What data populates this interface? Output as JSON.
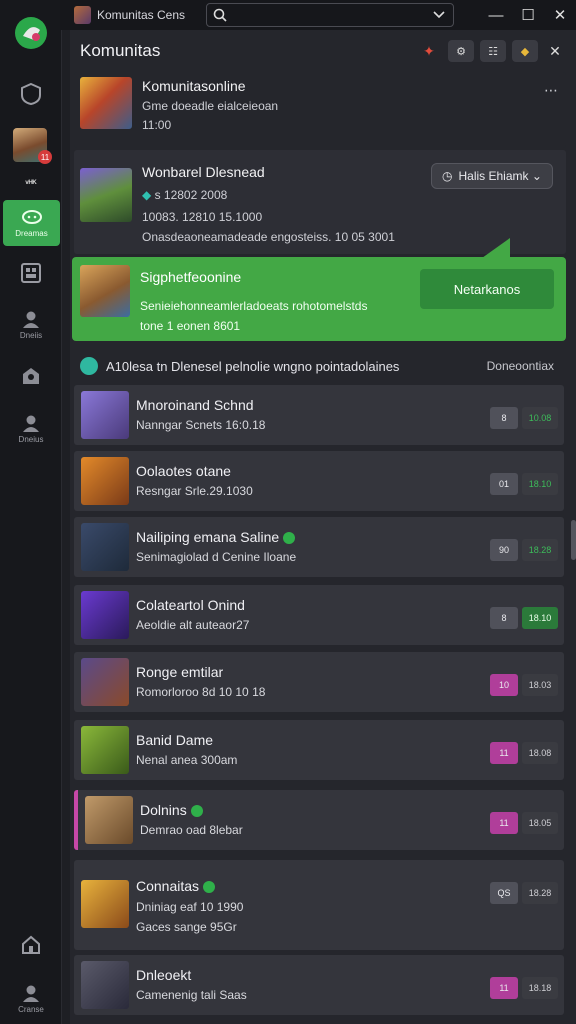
{
  "window": {
    "app_title": "Komunitas Cens",
    "search_placeholder": "",
    "min": "—",
    "max": "☐",
    "close": "✕"
  },
  "rail": {
    "active_label": "Dreamas",
    "items": [
      {
        "label": "Dneiis"
      },
      {
        "label": "Dneius"
      },
      {
        "label": "Cranse"
      }
    ],
    "badge": "11"
  },
  "header": {
    "title": "Komunitas",
    "close": "✕"
  },
  "top_item": {
    "title": "Komunitasonline",
    "sub1": "Gme doeadle eialceieoan",
    "sub2": "11:00",
    "more": "⋯"
  },
  "featured": {
    "title": "Wonbarel Dlesnead",
    "line1": "s 12802 2008",
    "line2": "10083. 12810 15.1000",
    "line3": "Onasdeaoneamadeade engosteiss. 10 05 3001",
    "button": "Halis Ehiamk ⌄"
  },
  "green_card": {
    "title": "Sigphetfeoonine",
    "line1": "Senieiehonneamlerladoeats rohotomelstds",
    "line2": "tone 1 eonen 8601",
    "button": "Netarkanos"
  },
  "section": {
    "title": "A10lesa tn Dlenesel pelnolie wngno pointadolaines",
    "right": "Doneoontiax"
  },
  "rows": [
    {
      "title": "Mnoroinand Schnd",
      "sub": "Nanngar Scnets 16:0.18",
      "code": "8",
      "tag": "10.08"
    },
    {
      "title": "Oolaotes otane",
      "sub": "Resngar Srle.29.1030",
      "code": "01",
      "tag": "18.10"
    },
    {
      "title": "Nailiping emana Saline",
      "sub": "Senimagiolad d Cenine Iloane",
      "code": "90",
      "tag": "18.28"
    },
    {
      "title": "Colateartol Onind",
      "sub": "Aeoldie alt auteaor27",
      "code": "8",
      "tag": "18.10"
    },
    {
      "title": "Ronge emtilar",
      "sub": "Romorloroo 8d 10 10 18",
      "code": "10",
      "tag": "18.03"
    },
    {
      "title": "Banid Dame",
      "sub": "Nenal anea 300am",
      "code": "11",
      "tag": "18.08"
    },
    {
      "title": "Dolnins",
      "sub": "Demrao oad 8lebar",
      "code": "11",
      "tag": "18.05"
    },
    {
      "title": "Connaitas",
      "sub": "Dniniag eaf 10 1990",
      "sub2": "Gaces sange 95Gr",
      "code": "QS",
      "tag": "18.28"
    },
    {
      "title": "Dnleoekt",
      "sub": "Camenenig tali Saas",
      "code": "11",
      "tag": "18.18"
    }
  ],
  "colors": {
    "accent_green": "#43a845",
    "pink": "#b03e9a",
    "bg": "#1e1f24"
  }
}
